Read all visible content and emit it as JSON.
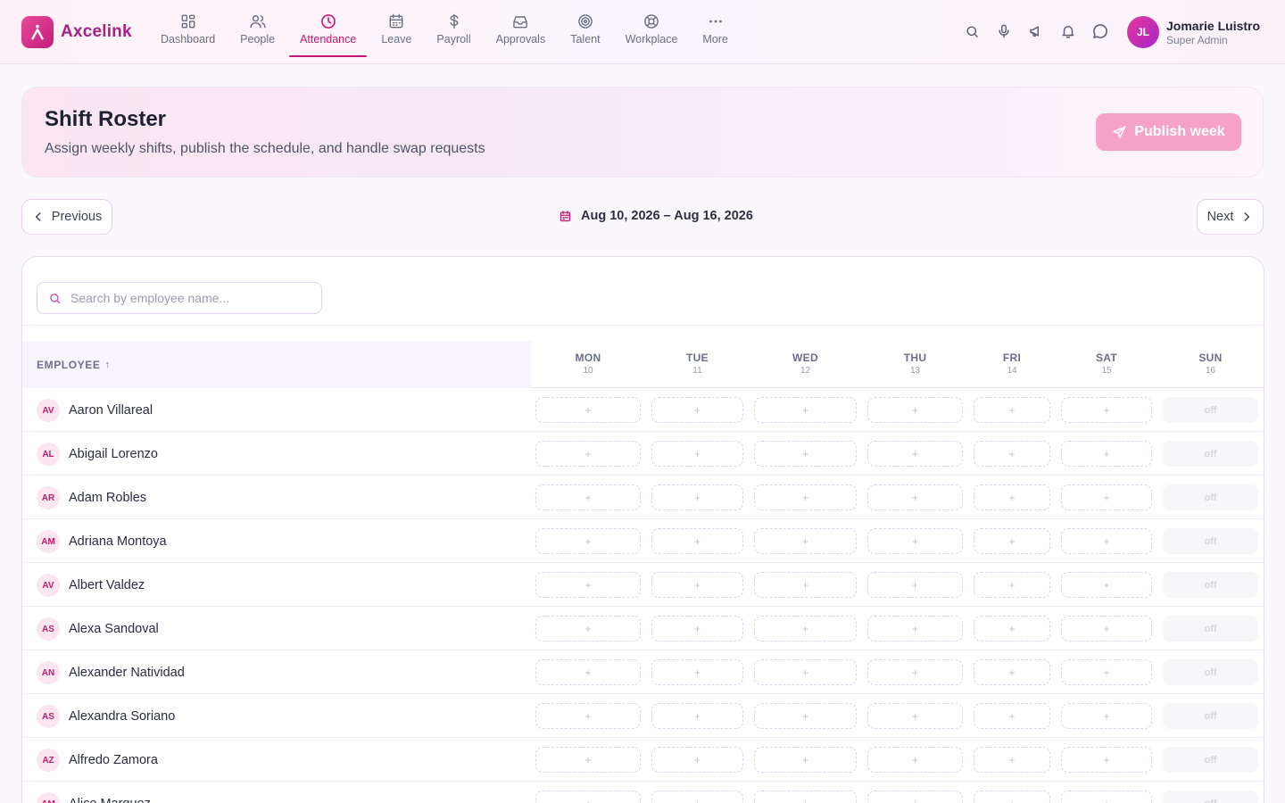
{
  "brand": {
    "name": "Axcelink"
  },
  "nav": [
    {
      "label": "Dashboard",
      "icon": "dashboard-icon"
    },
    {
      "label": "People",
      "icon": "people-icon"
    },
    {
      "label": "Attendance",
      "icon": "clock-icon",
      "active": true
    },
    {
      "label": "Leave",
      "icon": "calendar-icon"
    },
    {
      "label": "Payroll",
      "icon": "dollar-icon"
    },
    {
      "label": "Approvals",
      "icon": "inbox-icon"
    },
    {
      "label": "Talent",
      "icon": "target-icon"
    },
    {
      "label": "Workplace",
      "icon": "lifebuoy-icon"
    },
    {
      "label": "More",
      "icon": "more-icon"
    }
  ],
  "user": {
    "initials": "JL",
    "name": "Jomarie Luistro",
    "role": "Super Admin"
  },
  "header": {
    "title": "Shift Roster",
    "subtitle": "Assign weekly shifts, publish the schedule, and handle swap requests",
    "publish_label": "Publish week"
  },
  "week": {
    "prev_label": "Previous",
    "next_label": "Next",
    "range": "Aug 10, 2026 – Aug 16, 2026"
  },
  "search": {
    "placeholder": "Search by employee name..."
  },
  "table": {
    "employee_header": "EMPLOYEE",
    "sort_indicator": "↑",
    "days": [
      {
        "name": "MON",
        "num": "10"
      },
      {
        "name": "TUE",
        "num": "11"
      },
      {
        "name": "WED",
        "num": "12"
      },
      {
        "name": "THU",
        "num": "13"
      },
      {
        "name": "FRI",
        "num": "14"
      },
      {
        "name": "SAT",
        "num": "15"
      },
      {
        "name": "SUN",
        "num": "16"
      }
    ],
    "empty_cell": "+",
    "off_label": "off",
    "rows": [
      {
        "initials": "AV",
        "name": "Aaron Villareal"
      },
      {
        "initials": "AL",
        "name": "Abigail Lorenzo"
      },
      {
        "initials": "AR",
        "name": "Adam Robles"
      },
      {
        "initials": "AM",
        "name": "Adriana Montoya"
      },
      {
        "initials": "AV",
        "name": "Albert Valdez"
      },
      {
        "initials": "AS",
        "name": "Alexa Sandoval"
      },
      {
        "initials": "AN",
        "name": "Alexander Natividad"
      },
      {
        "initials": "AS",
        "name": "Alexandra Soriano"
      },
      {
        "initials": "AZ",
        "name": "Alfredo Zamora"
      },
      {
        "initials": "AM",
        "name": "Alice Marquez"
      }
    ]
  },
  "colors": {
    "accent": "#c4176f",
    "publish": "#f6a2c8",
    "brand": "#a32384"
  }
}
